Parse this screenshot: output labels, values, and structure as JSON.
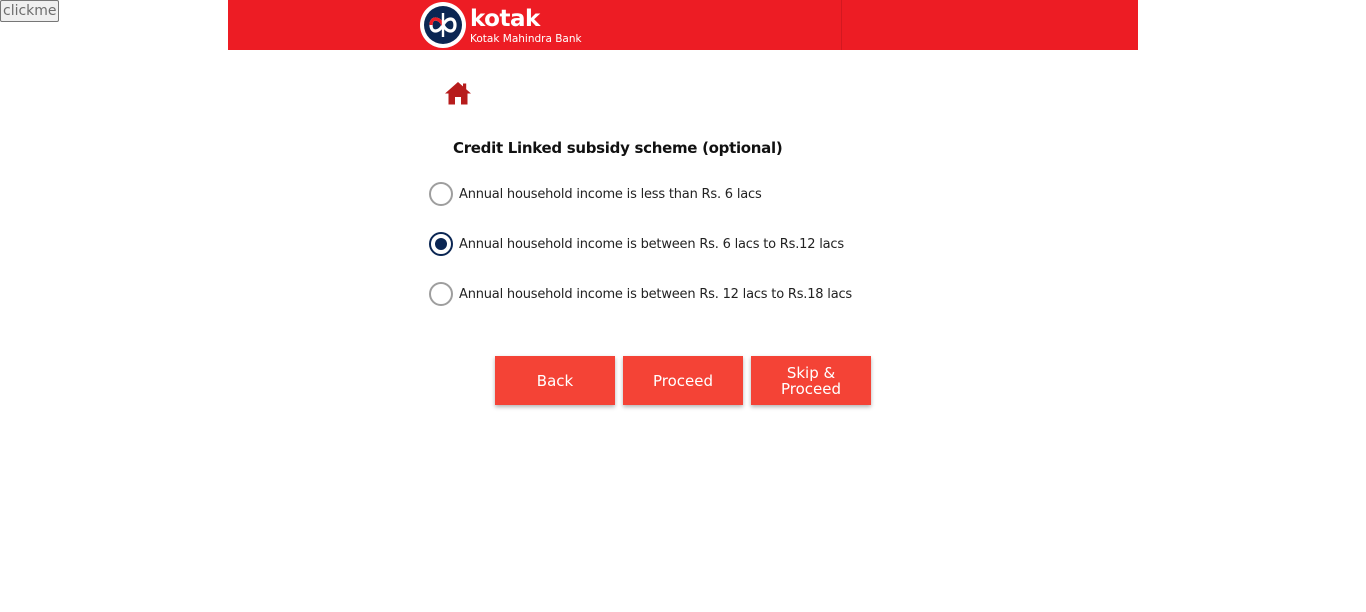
{
  "debug_button": {
    "label": "clickme"
  },
  "header": {
    "logo_word": "kotak",
    "logo_subtitle": "Kotak Mahindra Bank",
    "background_color": "#ed1c24"
  },
  "nav": {
    "home_icon": "home-icon"
  },
  "form": {
    "title": "Credit Linked subsidy scheme (optional)",
    "options": [
      {
        "label": "Annual household income is less than Rs. 6 lacs",
        "selected": false
      },
      {
        "label": "Annual household income is between Rs. 6 lacs to Rs.12 lacs",
        "selected": true
      },
      {
        "label": "Annual household income is between Rs. 12 lacs to Rs.18 lacs",
        "selected": false
      }
    ]
  },
  "actions": {
    "back_label": "Back",
    "proceed_label": "Proceed",
    "skip_label_line1": "Skip &",
    "skip_label_line2": "Proceed",
    "button_color": "#f44336"
  },
  "colors": {
    "radio_selected": "#0b2653",
    "radio_unselected": "#9e9e9e",
    "home_icon": "#b71c1c"
  }
}
